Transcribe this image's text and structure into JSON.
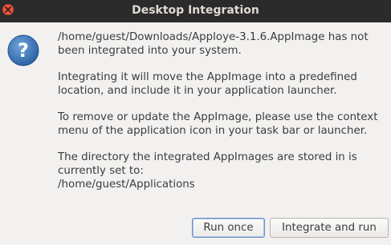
{
  "window": {
    "title": "Desktop Integration"
  },
  "icons": {
    "close": "close-icon",
    "dialog": "question-icon"
  },
  "colors": {
    "titlebar": "#2b2b2b",
    "close_button": "#e9573e",
    "question_icon": "#3b74b5",
    "background": "#f2f1f0"
  },
  "message": {
    "paragraph1_line1": "/home/guest/Downloads/Apploye-3.1.6.AppImage has not",
    "paragraph1_line2": "been integrated into your system.",
    "paragraph2_line1": "Integrating it will move the AppImage into a predefined",
    "paragraph2_line2": "location, and include it in your application launcher.",
    "paragraph3_line1": "To remove or update the AppImage, please use the context",
    "paragraph3_line2": "menu of the application icon in your task bar or launcher.",
    "paragraph4_line1": "The directory the integrated AppImages are stored in is",
    "paragraph4_line2": "currently set to:",
    "paragraph4_line3": "/home/guest/Applications"
  },
  "buttons": {
    "run_once": "Run once",
    "integrate_and_run": "Integrate and run"
  }
}
